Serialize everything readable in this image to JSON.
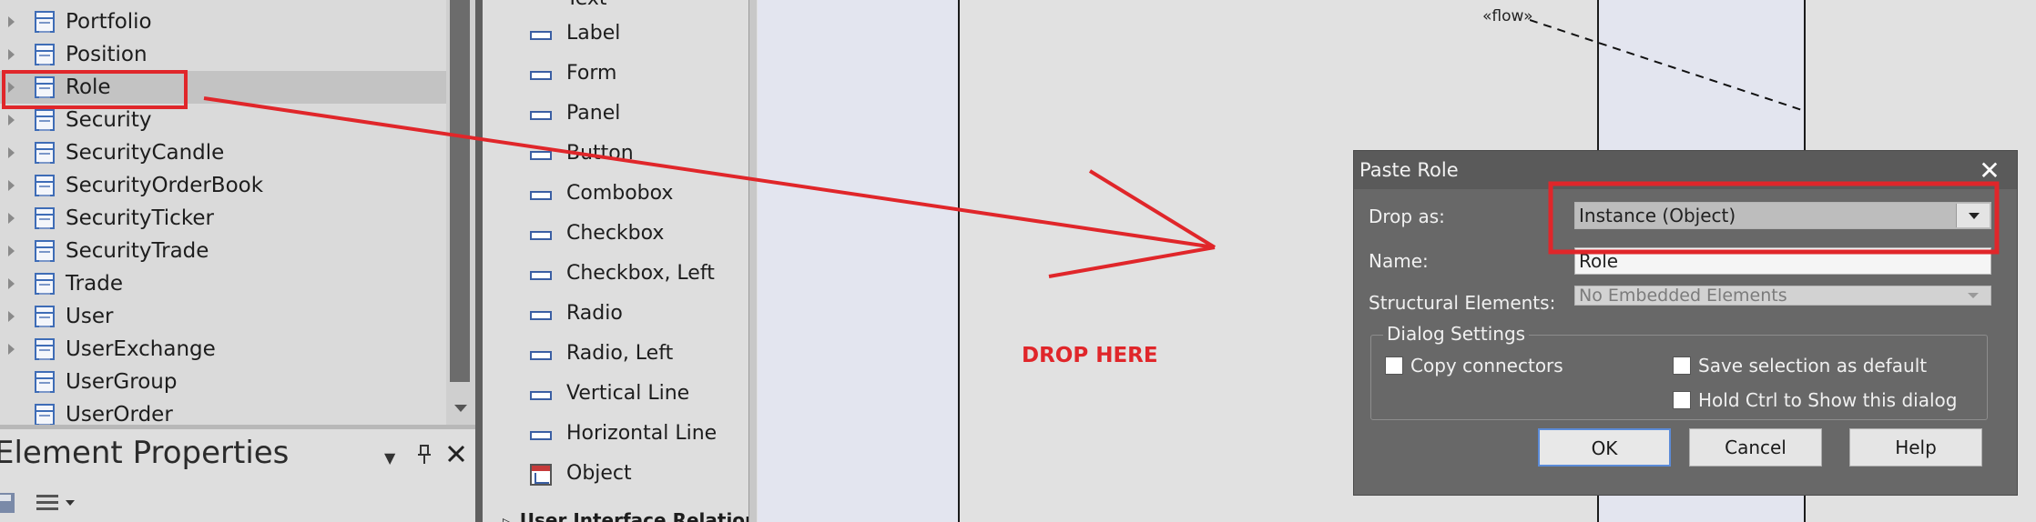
{
  "tree": {
    "items": [
      {
        "label": "Portfolio",
        "expandable": true
      },
      {
        "label": "Position",
        "expandable": true
      },
      {
        "label": "Role",
        "expandable": true,
        "selected": true
      },
      {
        "label": "Security",
        "expandable": true
      },
      {
        "label": "SecurityCandle",
        "expandable": true
      },
      {
        "label": "SecurityOrderBook",
        "expandable": true
      },
      {
        "label": "SecurityTicker",
        "expandable": true
      },
      {
        "label": "SecurityTrade",
        "expandable": true
      },
      {
        "label": "Trade",
        "expandable": true
      },
      {
        "label": "User",
        "expandable": true
      },
      {
        "label": "UserExchange",
        "expandable": true
      },
      {
        "label": "UserGroup",
        "expandable": false
      },
      {
        "label": "UserOrder",
        "expandable": false
      }
    ]
  },
  "element_properties": {
    "title": "Element Properties",
    "dropdown_glyph": "▼",
    "pin_glyph": "📌",
    "close_glyph": "✕"
  },
  "toolbox": {
    "partial_top_label": "Text",
    "items": [
      {
        "label": "Label",
        "icon": "ui-control-icon"
      },
      {
        "label": "Form",
        "icon": "ui-control-icon"
      },
      {
        "label": "Panel",
        "icon": "ui-control-icon"
      },
      {
        "label": "Button",
        "icon": "ui-control-icon"
      },
      {
        "label": "Combobox",
        "icon": "ui-control-icon"
      },
      {
        "label": "Checkbox",
        "icon": "ui-control-icon"
      },
      {
        "label": "Checkbox, Left",
        "icon": "ui-control-icon"
      },
      {
        "label": "Radio",
        "icon": "ui-control-icon"
      },
      {
        "label": "Radio, Left",
        "icon": "ui-control-icon"
      },
      {
        "label": "Vertical Line",
        "icon": "ui-control-icon"
      },
      {
        "label": "Horizontal Line",
        "icon": "ui-control-icon"
      },
      {
        "label": "Object",
        "icon": "object-icon"
      }
    ],
    "section_label": "User Interface Relationsh"
  },
  "canvas": {
    "flow_label": "«flow»",
    "edge_text": "",
    "drop_here": "DROP HERE"
  },
  "dialog": {
    "title": "Paste Role",
    "close": "✕",
    "drop_as_label": "Drop as:",
    "drop_as_value": "Instance (Object)",
    "name_label": "Name:",
    "name_value": "Role",
    "structural_label": "Structural Elements:",
    "structural_value": "No Embedded Elements",
    "settings_group": "Dialog Settings",
    "copy_connectors": "Copy connectors",
    "save_default": "Save selection as default",
    "hold_ctrl": "Hold Ctrl to Show this dialog",
    "ok": "OK",
    "cancel": "Cancel",
    "help": "Help"
  },
  "colors": {
    "annotation_red": "#e0262a",
    "dialog_bg": "#686868",
    "selection": "#c3c3c3"
  }
}
